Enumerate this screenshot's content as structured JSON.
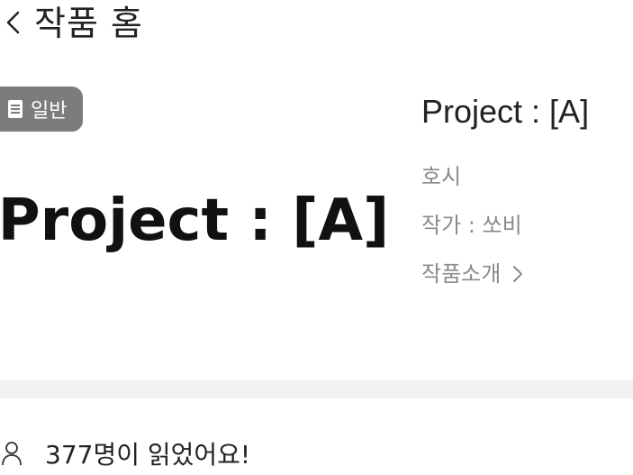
{
  "header": {
    "back_icon": "chevron-left-icon",
    "title": "작품 홈"
  },
  "badge": {
    "icon": "document-icon",
    "label": "일반"
  },
  "cover": {
    "title": "Project : [A]"
  },
  "info": {
    "title": "Project : [A]",
    "genre": "호시",
    "author": "작가 : 쏘비",
    "intro_label": "작품소개",
    "intro_icon": "chevron-right-icon"
  },
  "readers": {
    "icon": "person-icon",
    "text": "377명이 읽었어요!"
  }
}
